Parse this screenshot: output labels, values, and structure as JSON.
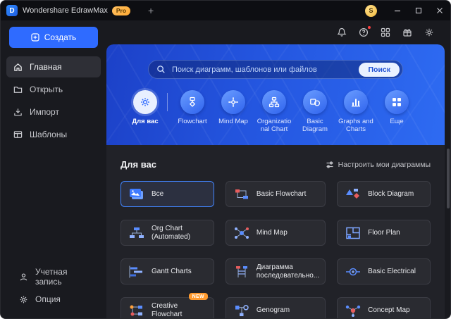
{
  "window": {
    "title": "Wondershare EdrawMax",
    "pro_badge": "Pro",
    "avatar_text": "S"
  },
  "colors": {
    "accent": "#2f6bff",
    "banner_from": "#1c41c8",
    "banner_to": "#2e6bf2",
    "new_badge": "#ff9a2e",
    "pro_badge": "#ffaa33",
    "avatar": "#f0b73c",
    "selected_border": "#4285ff"
  },
  "sidebar": {
    "create_label": "Создать",
    "items": [
      {
        "label": "Главная"
      },
      {
        "label": "Открыть"
      },
      {
        "label": "Импорт"
      },
      {
        "label": "Шаблоны"
      }
    ],
    "bottom_items": [
      {
        "label": "Учетная запись"
      },
      {
        "label": "Опция"
      }
    ]
  },
  "banner": {
    "search_placeholder": "Поиск диаграмм, шаблонов или файлов",
    "search_button": "Поиск",
    "categories": [
      {
        "label": "Для вас"
      },
      {
        "label": "Flowchart"
      },
      {
        "label": "Mind Map"
      },
      {
        "label": "Organizatio\nnal Chart"
      },
      {
        "label": "Basic Diagram"
      },
      {
        "label": "Graphs and Charts"
      },
      {
        "label": "Еще"
      }
    ]
  },
  "main": {
    "section_title": "Для вас",
    "customize_label": "Настроить мои диаграммы",
    "cards": [
      {
        "label": "Все"
      },
      {
        "label": "Basic Flowchart"
      },
      {
        "label": "Block Diagram"
      },
      {
        "label": "Org Chart (Automated)"
      },
      {
        "label": "Mind Map"
      },
      {
        "label": "Floor Plan"
      },
      {
        "label": "Gantt Charts"
      },
      {
        "label": "Диаграмма последовательно..."
      },
      {
        "label": "Basic Electrical"
      },
      {
        "label": "Creative Flowchart",
        "badge": "NEW"
      },
      {
        "label": "Genogram"
      },
      {
        "label": "Concept Map"
      }
    ]
  }
}
